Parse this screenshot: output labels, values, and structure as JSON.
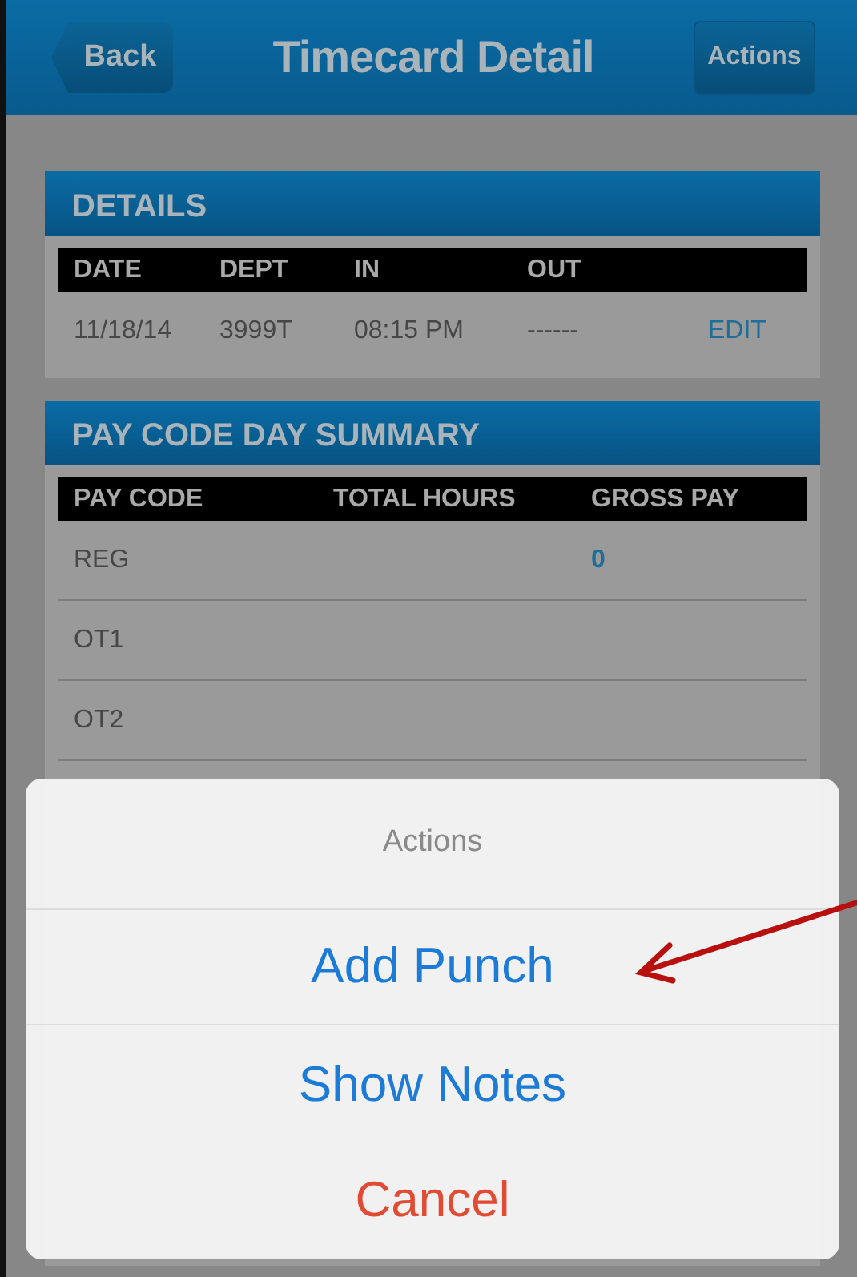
{
  "nav": {
    "back": "Back",
    "title": "Timecard Detail",
    "actions": "Actions"
  },
  "details": {
    "title": "DETAILS",
    "columns": [
      "DATE",
      "DEPT",
      "IN",
      "OUT"
    ],
    "rows": [
      {
        "cells": [
          "11/18/14",
          "3999T",
          "08:15 PM",
          "------"
        ],
        "action": "EDIT"
      }
    ]
  },
  "summary": {
    "title": "PAY CODE DAY SUMMARY",
    "columns": [
      "PAY CODE",
      "TOTAL HOURS",
      "GROSS PAY"
    ],
    "rows": [
      {
        "pay_code": "REG",
        "gross_pay": "0"
      },
      {
        "pay_code": "OT1"
      },
      {
        "pay_code": "OT2"
      }
    ]
  },
  "action_sheet": {
    "title": "Actions",
    "options": [
      {
        "label": "Add Punch",
        "kind": "default"
      },
      {
        "label": "Show Notes",
        "kind": "default"
      },
      {
        "label": "Cancel",
        "kind": "cancel"
      }
    ]
  }
}
